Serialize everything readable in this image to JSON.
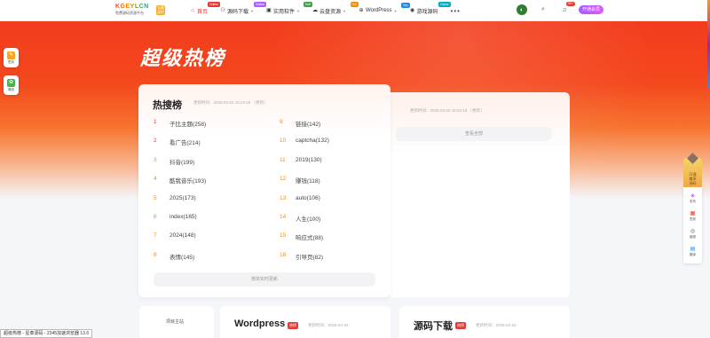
{
  "site": {
    "logo_text": "KGEYLCN",
    "logo_sub": "免费源码资源平台",
    "logo_badge": "宝藏福利"
  },
  "nav": {
    "items": [
      {
        "icon": "⌂",
        "label": "首页",
        "tag": "Online",
        "tag_color": "#e53935",
        "active": true,
        "caret": false
      },
      {
        "icon": "⚇",
        "label": "源码下载",
        "tag": "Online",
        "tag_color": "#b15cff",
        "active": false,
        "caret": true
      },
      {
        "icon": "▣",
        "label": "实用软件",
        "tag": "Soft",
        "tag_color": "#43a047",
        "active": false,
        "caret": true
      },
      {
        "icon": "☁",
        "label": "云盘资源",
        "tag": "Hot",
        "tag_color": "#fb8c00",
        "active": false,
        "caret": true
      },
      {
        "icon": "⊕",
        "label": "WordPress",
        "tag": "Wp",
        "tag_color": "#1e88e5",
        "active": false,
        "caret": true
      },
      {
        "icon": "◉",
        "label": "游戏源码",
        "tag": "Game",
        "tag_color": "#00acc1",
        "active": false,
        "caret": false
      }
    ],
    "more": "•••",
    "notif_count": "99+",
    "vip_label": "开通会员"
  },
  "hero": {
    "title": "超级热榜"
  },
  "left_float": [
    {
      "label": "签到",
      "color": "#f5a623",
      "icon": "✎"
    },
    {
      "label": "赚钱",
      "color": "#4caf50",
      "icon": "✿"
    }
  ],
  "hot_card": {
    "title": "热搜榜",
    "time": "更新时间：2025-04-22 10:24:19 （更新）",
    "col1": [
      {
        "n": "1",
        "text": "子比主题(258)"
      },
      {
        "n": "2",
        "text": "看广告(214)"
      },
      {
        "n": "3",
        "text": "抖音(199)"
      },
      {
        "n": "4",
        "text": "酷我音乐(193)"
      },
      {
        "n": "5",
        "text": "2025(173)"
      },
      {
        "n": "6",
        "text": "index(165)"
      },
      {
        "n": "7",
        "text": "2024(148)"
      },
      {
        "n": "8",
        "text": "表情(145)"
      }
    ],
    "col2": [
      {
        "n": "9",
        "text": "链接(142)"
      },
      {
        "n": "10",
        "text": "captcha(132)"
      },
      {
        "n": "11",
        "text": "2019(130)"
      },
      {
        "n": "12",
        "text": "赚钱(118)"
      },
      {
        "n": "13",
        "text": "auto(106)"
      },
      {
        "n": "14",
        "text": "人生(100)"
      },
      {
        "n": "15",
        "text": "响应式(88)"
      },
      {
        "n": "16",
        "text": "引导页(82)"
      }
    ],
    "button": "榜单实时更新"
  },
  "second_card": {
    "time": "更新时间：2025-04-22 10:24:19 （更新）",
    "button": "查看全部"
  },
  "right_side": {
    "top_label1": "开通",
    "top_label2": "尊享",
    "top_label3": "源码",
    "items": [
      {
        "icon": "◈",
        "label": "发布",
        "color": "#b15cff"
      },
      {
        "icon": "▦",
        "label": "签到",
        "color": "#e53935"
      },
      {
        "icon": "◎",
        "label": "客服",
        "color": "#555"
      },
      {
        "icon": "▤",
        "label": "翻译",
        "color": "#1e88e5"
      }
    ]
  },
  "bottom": {
    "side_label": "项目主站",
    "card1": {
      "title": "Wordpress",
      "badge": "热榜",
      "time": "更新时间：2025-04-22"
    },
    "card2": {
      "title": "源码下载",
      "badge": "热榜",
      "time": "更新时间：2025-04-22"
    }
  },
  "statusbar": "超级热榜 - 星泰源码 - 2345加速浏览器 13.6"
}
